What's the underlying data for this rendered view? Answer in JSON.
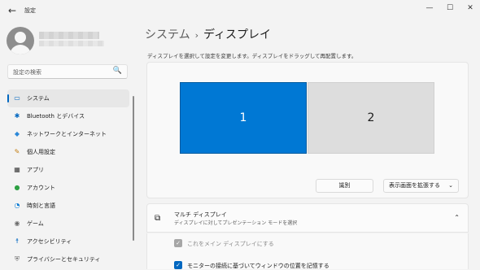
{
  "window": {
    "app_title": "設定",
    "back_glyph": "←",
    "minimize_glyph": "—",
    "maximize_glyph": "☐",
    "close_glyph": "✕"
  },
  "search": {
    "placeholder": "設定の検索",
    "icon": "🔍"
  },
  "nav": {
    "items": [
      {
        "label": "システム",
        "icon": "▭",
        "color": "#0067c0",
        "active": true
      },
      {
        "label": "Bluetooth とデバイス",
        "icon": "✱",
        "color": "#0067c0"
      },
      {
        "label": "ネットワークとインターネット",
        "icon": "◆",
        "color": "#2b88d8"
      },
      {
        "label": "個人用設定",
        "icon": "✎",
        "color": "#c27c0e"
      },
      {
        "label": "アプリ",
        "icon": "▦",
        "color": "#3a3a3a"
      },
      {
        "label": "アカウント",
        "icon": "●",
        "color": "#2ea043"
      },
      {
        "label": "時刻と言語",
        "icon": "◔",
        "color": "#0078d4"
      },
      {
        "label": "ゲーム",
        "icon": "◉",
        "color": "#6b6b6b"
      },
      {
        "label": "アクセシビリティ",
        "icon": "☨",
        "color": "#0067c0"
      },
      {
        "label": "プライバシーとセキュリティ",
        "icon": "⛨",
        "color": "#6b6b6b"
      }
    ]
  },
  "header": {
    "breadcrumb": "システム",
    "separator": "›",
    "title": "ディスプレイ"
  },
  "hint": "ディスプレイを選択して設定を変更します。ディスプレイをドラッグして再配置します。",
  "monitors": [
    {
      "label": "1",
      "selected": true
    },
    {
      "label": "2",
      "selected": false
    }
  ],
  "buttons": {
    "identify": "識別",
    "extend": "表示画面を拡張する",
    "extend_chevron": "⌄"
  },
  "multi_display": {
    "icon": "⧉",
    "title": "マルチ ディスプレイ",
    "subtitle": "ディスプレイに対してプレゼンテーション モードを選択",
    "collapse_glyph": "⌃"
  },
  "options": [
    {
      "label": "これをメイン ディスプレイにする",
      "checked": true,
      "disabled": true
    },
    {
      "label": "モニターの接続に基づいてウィンドウの位置を記憶する",
      "checked": true,
      "disabled": false
    }
  ],
  "colors": {
    "accent": "#0078d4",
    "background": "#f3f3f3"
  }
}
